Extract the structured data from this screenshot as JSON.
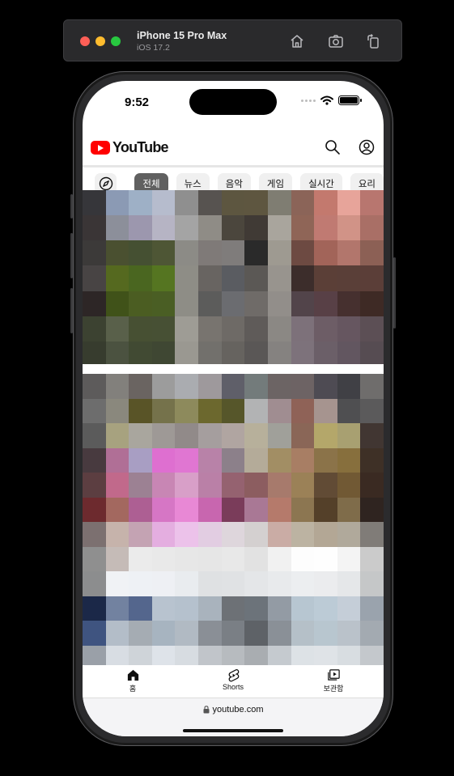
{
  "simulator": {
    "device_name": "iPhone 15 Pro Max",
    "os_version": "iOS 17.2",
    "icons": [
      "home-icon",
      "screenshot-icon",
      "rotate-icon"
    ]
  },
  "status_bar": {
    "time": "9:52"
  },
  "header": {
    "logo_text": "YouTube",
    "icons": [
      "search-icon",
      "account-icon"
    ]
  },
  "chips": [
    {
      "label": "전체",
      "active": true
    },
    {
      "label": "뉴스",
      "active": false
    },
    {
      "label": "음악",
      "active": false
    },
    {
      "label": "게임",
      "active": false
    },
    {
      "label": "실시간",
      "active": false
    },
    {
      "label": "요리",
      "active": false
    }
  ],
  "tabbar": {
    "home_label": "홈",
    "shorts_label": "Shorts",
    "library_label": "보관함"
  },
  "safari": {
    "url": "youtube.com"
  },
  "mosaic_colors": {
    "thumb1": [
      "#36363a",
      "#8b9ab4",
      "#9eb0c6",
      "#b6bccd",
      "#8f8f8f",
      "#575350",
      "#5d5640",
      "#5e5640",
      "#7f7d72",
      "#8b6458",
      "#c3796e",
      "#e7a49a",
      "#b8766f",
      "#3a3536",
      "#8c8f9a",
      "#9c97ae",
      "#b6b4c4",
      "#a4a4a4",
      "#8f8c86",
      "#4b463d",
      "#403a35",
      "#a9a59d",
      "#8f6557",
      "#c07a72",
      "#d19387",
      "#a96f66",
      "#3c3a39",
      "#4a5030",
      "#455032",
      "#4e5635",
      "#8c8b86",
      "#7f7a78",
      "#7f7c7b",
      "#2a2a2a",
      "#9e9a91",
      "#6d4a42",
      "#a26459",
      "#b2766c",
      "#8c6055",
      "#484444",
      "#55691f",
      "#4a6620",
      "#557521",
      "#8e8d86",
      "#686461",
      "#5a5c61",
      "#5b5855",
      "#98948e",
      "#3c2d2b",
      "#5b3f37",
      "#5a3f38",
      "#5b3e38",
      "#2d2626",
      "#405219",
      "#4b5d22",
      "#4a5e24",
      "#8e8d86",
      "#5c5c5b",
      "#6b6c70",
      "#6f6b68",
      "#928e8a",
      "#52444a",
      "#584046",
      "#46302f",
      "#3e2a25",
      "#3c4231",
      "#59604a",
      "#475033",
      "#475034",
      "#9e9c95",
      "#78746f",
      "#6e6a66",
      "#5f5b59",
      "#8b8884",
      "#7d717a",
      "#6d5d66",
      "#665660",
      "#5c4f55",
      "#373c2e",
      "#4b5240",
      "#414a33",
      "#3f4733",
      "#9a9891",
      "#72706c",
      "#66635f",
      "#5a5756",
      "#858280",
      "#7d727b",
      "#6b5f68",
      "#625660",
      "#564c52"
    ],
    "thumb2": [
      "#5d5b5b",
      "#82807c",
      "#6a6461",
      "#9c9c9c",
      "#aaacb0",
      "#9e999c",
      "#5f5f69",
      "#737b7b",
      "#6c6464",
      "#6d6364",
      "#4e4b53",
      "#404045",
      "#6f6d6c",
      "#6d6d6d",
      "#8a887d",
      "#595427",
      "#75724b",
      "#8d8a5c",
      "#6c682e",
      "#56562a",
      "#b2b3b4",
      "#a08d91",
      "#8f6257",
      "#a6948f",
      "#4f4f51",
      "#5b5a5b",
      "#5b5b5b",
      "#a7a27f",
      "#a9a69e",
      "#9e9996",
      "#918a89",
      "#a59e9e",
      "#b0a5a1",
      "#b7b09b",
      "#a0a09a",
      "#8a6657",
      "#b4a76a",
      "#a8a071",
      "#413632",
      "#483a3f",
      "#b06f96",
      "#a89ec3",
      "#de6fd0",
      "#e076d2",
      "#b882a8",
      "#8c808a",
      "#b4ab99",
      "#a28e64",
      "#a87e64",
      "#8b7349",
      "#876f3d",
      "#3e3026",
      "#5c3e41",
      "#c1698b",
      "#9c8193",
      "#c886b4",
      "#d89fc8",
      "#ba80a7",
      "#956270",
      "#8c5d60",
      "#a77a6c",
      "#9b8157",
      "#614b35",
      "#715934",
      "#3a2a22",
      "#6d2a2e",
      "#a3685f",
      "#ad5f93",
      "#d676c5",
      "#e888d5",
      "#c866af",
      "#7a3c5a",
      "#a97895",
      "#b57a6b",
      "#8c7651",
      "#544029",
      "#7f6c4a",
      "#2f2420",
      "#7c7070",
      "#c6b3ab",
      "#c4a3b3",
      "#e4aee0",
      "#ecc2ea",
      "#e2cde2",
      "#ded6dc",
      "#d4d0d0",
      "#caaca5",
      "#bcb3a2",
      "#b3a795",
      "#b0a99b",
      "#807c78",
      "#8f8f8f",
      "#c5bbb7",
      "#ebebeb",
      "#e9e9e9",
      "#e7e7e7",
      "#e6e6e6",
      "#e8e8e8",
      "#e2e2e2",
      "#f1f1f1",
      "#fdfdfd",
      "#fefefe",
      "#f4f4f4",
      "#cbcbcb",
      "#8c8d8e",
      "#f0f2f5",
      "#eef1f5",
      "#eef0f4",
      "#e9ecef",
      "#dfe1e3",
      "#e0e2e4",
      "#e4e6e8",
      "#e8eaec",
      "#eceef0",
      "#ebecee",
      "#e5e7e9",
      "#c5c7c8",
      "#1b2848",
      "#7282a0",
      "#54668d",
      "#b8c3cf",
      "#b5c1cd",
      "#a9b3bd",
      "#6d7176",
      "#6c737a",
      "#939ba4",
      "#b7c6d1",
      "#bccbd6",
      "#c5ced8",
      "#9aa3ad",
      "#3f5480",
      "#b3bdc8",
      "#a5acb3",
      "#a7b4c0",
      "#b1bac3",
      "#8a8f96",
      "#7a7f85",
      "#5e6267",
      "#8a9097",
      "#b5c0c8",
      "#b8c6cf",
      "#bac2ca",
      "#a3aab1",
      "#9aa0a8",
      "#d8dde3",
      "#cfd4d9",
      "#dee3e9",
      "#d7dce1",
      "#c1c5ca",
      "#b7bbbf",
      "#a9adb1",
      "#c5cacf",
      "#dde2e6",
      "#dfe3e7",
      "#d8dde1",
      "#c4c8cc"
    ]
  }
}
